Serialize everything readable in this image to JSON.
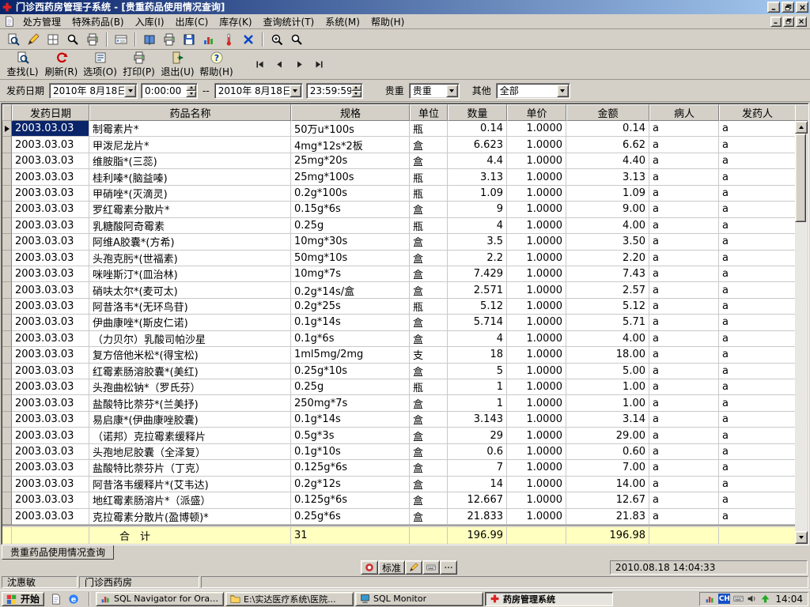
{
  "window": {
    "title": "门诊西药房管理子系统 - [贵重药品使用情况查询]",
    "controls": [
      "minimize",
      "restore",
      "close"
    ]
  },
  "menu": {
    "items": [
      "处方管理",
      "特殊药品(B)",
      "入库(I)",
      "出库(C)",
      "库存(K)",
      "查询统计(T)",
      "系统(M)",
      "帮助(H)"
    ]
  },
  "toolbar_icons": [
    "form-query",
    "edit",
    "grid",
    "search",
    "print",
    "card-index",
    "ledger",
    "report-print",
    "save",
    "chart",
    "thermometer",
    "cancel",
    "zoom",
    "magnifier"
  ],
  "actions": {
    "find": "查找(L)",
    "refresh": "刷新(R)",
    "options": "选项(O)",
    "print": "打印(P)",
    "exit": "退出(U)",
    "help": "帮助(H)"
  },
  "record_nav": [
    "first",
    "prior",
    "next",
    "last"
  ],
  "filters": {
    "date_label": "发药日期",
    "date_from": "2010年 8月18日",
    "time_from": "0:00:00",
    "range_separator": "--",
    "date_to": "2010年 8月18日",
    "time_to": "23:59:59",
    "precious_label": "贵重",
    "precious_value": "贵重",
    "other_label": "其他",
    "other_value": "全部"
  },
  "table": {
    "columns": [
      "发药日期",
      "药品名称",
      "规格",
      "单位",
      "数量",
      "单价",
      "金额",
      "病人",
      "发药人"
    ],
    "rows": [
      [
        "2003.03.03",
        "制霉素片*",
        "50万u*100s",
        "瓶",
        "0.14",
        "1.0000",
        "0.14",
        "a",
        "a"
      ],
      [
        "2003.03.03",
        "甲泼尼龙片*",
        "4mg*12s*2板",
        "盒",
        "6.623",
        "1.0000",
        "6.62",
        "a",
        "a"
      ],
      [
        "2003.03.03",
        "维胺脂*(三蕊)",
        "25mg*20s",
        "盒",
        "4.4",
        "1.0000",
        "4.40",
        "a",
        "a"
      ],
      [
        "2003.03.03",
        "桂利嗪*(脑益嗪)",
        "25mg*100s",
        "瓶",
        "3.13",
        "1.0000",
        "3.13",
        "a",
        "a"
      ],
      [
        "2003.03.03",
        "甲硝唑*(灭滴灵)",
        "0.2g*100s",
        "瓶",
        "1.09",
        "1.0000",
        "1.09",
        "a",
        "a"
      ],
      [
        "2003.03.03",
        "罗红霉素分散片*",
        "0.15g*6s",
        "盒",
        "9",
        "1.0000",
        "9.00",
        "a",
        "a"
      ],
      [
        "2003.03.03",
        "乳糖酸阿奇霉素",
        "0.25g",
        "瓶",
        "4",
        "1.0000",
        "4.00",
        "a",
        "a"
      ],
      [
        "2003.03.03",
        "阿维A胶囊*(方希)",
        "10mg*30s",
        "盒",
        "3.5",
        "1.0000",
        "3.50",
        "a",
        "a"
      ],
      [
        "2003.03.03",
        "头孢克肟*(世福素)",
        "50mg*10s",
        "盒",
        "2.2",
        "1.0000",
        "2.20",
        "a",
        "a"
      ],
      [
        "2003.03.03",
        "咪唑斯汀*(皿治林)",
        "10mg*7s",
        "盒",
        "7.429",
        "1.0000",
        "7.43",
        "a",
        "a"
      ],
      [
        "2003.03.03",
        "硝呋太尔*(麦可太)",
        "0.2g*14s/盒",
        "盒",
        "2.571",
        "1.0000",
        "2.57",
        "a",
        "a"
      ],
      [
        "2003.03.03",
        "阿昔洛韦*(无环鸟苷)",
        "0.2g*25s",
        "瓶",
        "5.12",
        "1.0000",
        "5.12",
        "a",
        "a"
      ],
      [
        "2003.03.03",
        "伊曲康唑*(斯皮仁诺)",
        "0.1g*14s",
        "盒",
        "5.714",
        "1.0000",
        "5.71",
        "a",
        "a"
      ],
      [
        "2003.03.03",
        "（力贝尔）乳酸司帕沙星",
        "0.1g*6s",
        "盒",
        "4",
        "1.0000",
        "4.00",
        "a",
        "a"
      ],
      [
        "2003.03.03",
        "复方倍他米松*(得宝松)",
        "1ml5mg/2mg",
        "支",
        "18",
        "1.0000",
        "18.00",
        "a",
        "a"
      ],
      [
        "2003.03.03",
        "红霉素肠溶胶囊*(美红)",
        "0.25g*10s",
        "盒",
        "5",
        "1.0000",
        "5.00",
        "a",
        "a"
      ],
      [
        "2003.03.03",
        "头孢曲松钠*（罗氏芬）",
        "0.25g",
        "瓶",
        "1",
        "1.0000",
        "1.00",
        "a",
        "a"
      ],
      [
        "2003.03.03",
        "盐酸特比萘芬*(兰美抒)",
        "250mg*7s",
        "盒",
        "1",
        "1.0000",
        "1.00",
        "a",
        "a"
      ],
      [
        "2003.03.03",
        "易启康*(伊曲康唑胶囊)",
        "0.1g*14s",
        "盒",
        "3.143",
        "1.0000",
        "3.14",
        "a",
        "a"
      ],
      [
        "2003.03.03",
        "（诺邦）克拉霉素缓释片",
        "0.5g*3s",
        "盒",
        "29",
        "1.0000",
        "29.00",
        "a",
        "a"
      ],
      [
        "2003.03.03",
        "头孢地尼胶囊（全泽复）",
        "0.1g*10s",
        "盒",
        "0.6",
        "1.0000",
        "0.60",
        "a",
        "a"
      ],
      [
        "2003.03.03",
        "盐酸特比萘芬片（丁克）",
        "0.125g*6s",
        "盒",
        "7",
        "1.0000",
        "7.00",
        "a",
        "a"
      ],
      [
        "2003.03.03",
        "阿昔洛韦缓释片*(艾韦达)",
        "0.2g*12s",
        "盒",
        "14",
        "1.0000",
        "14.00",
        "a",
        "a"
      ],
      [
        "2003.03.03",
        "地红霉素肠溶片*（派盛）",
        "0.125g*6s",
        "盒",
        "12.667",
        "1.0000",
        "12.67",
        "a",
        "a"
      ],
      [
        "2003.03.03",
        "克拉霉素分散片(盈博顿)*",
        "0.25g*6s",
        "盒",
        "21.833",
        "1.0000",
        "21.83",
        "a",
        "a"
      ]
    ],
    "footer": {
      "label": "合　计",
      "spec": "31",
      "quantity": "196.99",
      "amount": "196.98"
    }
  },
  "bottom_tab": "贵重药品使用情况查询",
  "ime": {
    "mode": "标准"
  },
  "status": {
    "user": "沈惠敏",
    "department": "门诊西药房",
    "datetime": "2010.08.18 14:04:33"
  },
  "taskbar": {
    "start": "开始",
    "tasks": [
      "SQL Navigator for Oracle",
      "E:\\实达医疗系统\\医院...",
      "SQL Monitor",
      "药房管理系统"
    ],
    "active_task_index": 3,
    "tray_badge": "CH",
    "tray_time": "14:04"
  },
  "colors": {
    "titlebar_start": "#0a246a",
    "titlebar_end": "#a6caf0",
    "selection": "#0a246a",
    "footer_bg": "#ffffc0",
    "base": "#d4d0c8"
  }
}
